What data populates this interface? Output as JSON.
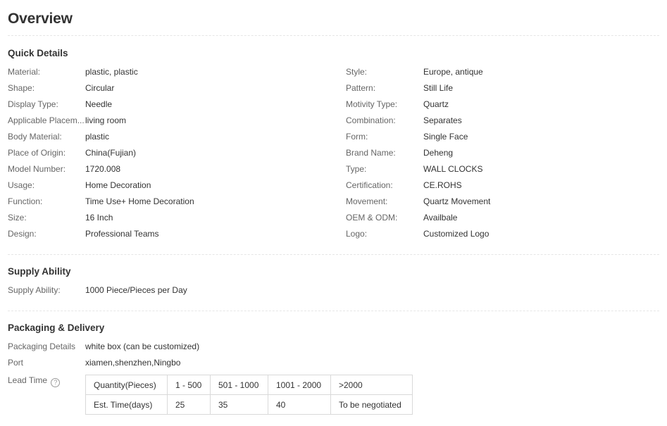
{
  "page": {
    "title": "Overview"
  },
  "quick_details": {
    "heading": "Quick Details",
    "left": [
      {
        "label": "Material:",
        "value": "plastic, plastic"
      },
      {
        "label": "Shape:",
        "value": "Circular"
      },
      {
        "label": "Display Type:",
        "value": "Needle"
      },
      {
        "label": "Applicable Placem...",
        "value": "living room"
      },
      {
        "label": "Body Material:",
        "value": "plastic"
      },
      {
        "label": "Place of Origin:",
        "value": "China(Fujian)"
      },
      {
        "label": "Model Number:",
        "value": "1720.008"
      },
      {
        "label": "Usage:",
        "value": "Home Decoration"
      },
      {
        "label": "Function:",
        "value": "Time Use+ Home Decoration"
      },
      {
        "label": "Size:",
        "value": "16 Inch"
      },
      {
        "label": "Design:",
        "value": "Professional Teams"
      }
    ],
    "right": [
      {
        "label": "Style:",
        "value": "Europe, antique"
      },
      {
        "label": "Pattern:",
        "value": "Still Life"
      },
      {
        "label": "Motivity Type:",
        "value": "Quartz"
      },
      {
        "label": "Combination:",
        "value": "Separates"
      },
      {
        "label": "Form:",
        "value": "Single Face"
      },
      {
        "label": "Brand Name:",
        "value": "Deheng"
      },
      {
        "label": "Type:",
        "value": "WALL CLOCKS"
      },
      {
        "label": "Certification:",
        "value": "CE.ROHS"
      },
      {
        "label": "Movement:",
        "value": "Quartz Movement"
      },
      {
        "label": "OEM & ODM:",
        "value": "Availbale"
      },
      {
        "label": "Logo:",
        "value": "Customized Logo"
      }
    ]
  },
  "supply": {
    "heading": "Supply Ability",
    "items": [
      {
        "label": "Supply Ability:",
        "value": "1000 Piece/Pieces per Day"
      }
    ]
  },
  "packaging": {
    "heading": "Packaging & Delivery",
    "items": [
      {
        "label": "Packaging Details",
        "value": "white box (can be customized)"
      },
      {
        "label": "Port",
        "value": "xiamen,shenzhen,Ningbo"
      }
    ],
    "lead_time": {
      "label": "Lead Time",
      "help_icon": "question-circle-icon",
      "rows": [
        [
          "Quantity(Pieces)",
          "1 - 500",
          "501 - 1000",
          "1001 - 2000",
          ">2000"
        ],
        [
          "Est. Time(days)",
          "25",
          "35",
          "40",
          "To be negotiated"
        ]
      ]
    }
  }
}
